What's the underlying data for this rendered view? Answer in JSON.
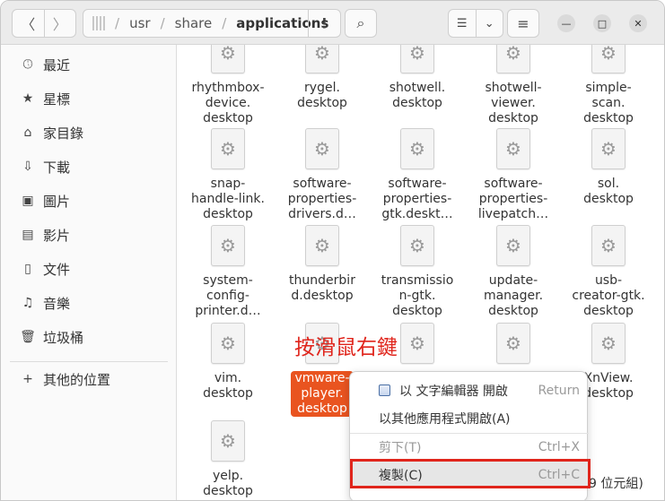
{
  "header": {
    "back_icon": "〈",
    "forward_icon": "〉",
    "path": [
      "usr",
      "share",
      "applications"
    ],
    "path_menu_icon": "⋮",
    "search_icon": "⌕",
    "view_list_icon": "☰",
    "view_dropdown_icon": "⌄",
    "menu_icon": "≡",
    "minimize_icon": "—",
    "maximize_icon": "□",
    "close_icon": "✕"
  },
  "sidebar": {
    "items": [
      {
        "label": "最近",
        "icon": "clock-icon"
      },
      {
        "label": "星標",
        "icon": "star-icon"
      },
      {
        "label": "家目錄",
        "icon": "home-icon"
      },
      {
        "label": "下載",
        "icon": "download-icon"
      },
      {
        "label": "圖片",
        "icon": "image-icon"
      },
      {
        "label": "影片",
        "icon": "film-icon"
      },
      {
        "label": "文件",
        "icon": "document-icon"
      },
      {
        "label": "音樂",
        "icon": "music-icon"
      },
      {
        "label": "垃圾桶",
        "icon": "trash-icon"
      }
    ],
    "other_locations": "其他的位置"
  },
  "files": [
    {
      "label": "rhythmbox-\ndevice.\ndesktop"
    },
    {
      "label": "rygel.\ndesktop"
    },
    {
      "label": "shotwell.\ndesktop"
    },
    {
      "label": "shotwell-\nviewer.\ndesktop"
    },
    {
      "label": "simple-\nscan.\ndesktop"
    },
    {
      "label": "snap-\nhandle-link.\ndesktop"
    },
    {
      "label": "software-\nproperties-\ndrivers.d…"
    },
    {
      "label": "software-\nproperties-\ngtk.deskt…"
    },
    {
      "label": "software-\nproperties-\nlivepatch…"
    },
    {
      "label": "sol.\ndesktop"
    },
    {
      "label": "system-\nconfig-\nprinter.d…"
    },
    {
      "label": "thunderbir\nd.desktop"
    },
    {
      "label": "transmissio\nn-gtk.\ndesktop"
    },
    {
      "label": "update-\nmanager.\ndesktop"
    },
    {
      "label": "usb-\ncreator-gtk.\ndesktop"
    },
    {
      "label": "vim.\ndesktop"
    },
    {
      "label": "vmware-\nplayer.\ndesktop"
    },
    {
      "label": ""
    },
    {
      "label": ""
    },
    {
      "label": "XnView.\ndesktop"
    },
    {
      "label": "yelp.\ndesktop"
    }
  ],
  "annotation": "按滑鼠右鍵",
  "context_menu": {
    "items": [
      {
        "label": "以 文字編輯器 開啟",
        "shortcut": "Return"
      },
      {
        "label": "以其他應用程式開啟(A)",
        "shortcut": ""
      },
      {
        "label": "剪下(T)",
        "shortcut": "Ctrl+X"
      },
      {
        "label": "複製(C)",
        "shortcut": "Ctrl+C"
      }
    ]
  },
  "status_text": "9 位元組)",
  "colors": {
    "accent": "#e95420",
    "annotation": "#e0251c"
  }
}
